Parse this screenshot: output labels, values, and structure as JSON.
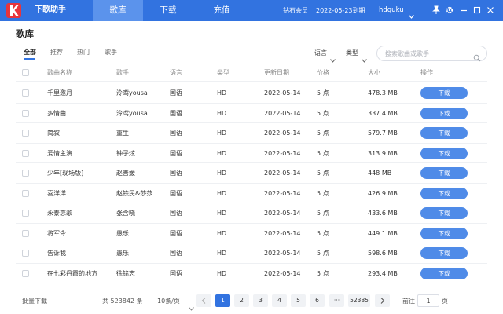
{
  "app": {
    "title": "下歌助手",
    "nav": [
      "歌库",
      "下载",
      "充值"
    ],
    "vip_label": "钻石会员",
    "expiry": "2022-05-23到期",
    "username": "hdquku"
  },
  "colors": {
    "topbar": "#3273e0",
    "nav_active": "#5b93ec",
    "logo": "#e8343c",
    "button": "#4f8be8"
  },
  "page": {
    "title": "歌库"
  },
  "sub_tabs": [
    "全部",
    "推荐",
    "热门",
    "歌手"
  ],
  "filters": {
    "language": "语言",
    "type": "类型"
  },
  "search": {
    "placeholder": "搜索歌曲或歌手"
  },
  "table": {
    "headers": [
      "歌曲名称",
      "歌手",
      "语言",
      "类型",
      "更新日期",
      "价格",
      "大小",
      "操作"
    ],
    "download_label": "下载",
    "rows": [
      [
        "千里邀月",
        "泠鸢yousa",
        "国语",
        "HD",
        "2022-05-14",
        "5 点",
        "478.3 MB"
      ],
      [
        "多情曲",
        "泠鸢yousa",
        "国语",
        "HD",
        "2022-05-14",
        "5 点",
        "337.4 MB"
      ],
      [
        "简叙",
        "重生",
        "国语",
        "HD",
        "2022-05-14",
        "5 点",
        "579.7 MB"
      ],
      [
        "爱情主演",
        "钟子炫",
        "国语",
        "HD",
        "2022-05-14",
        "5 点",
        "313.9 MB"
      ],
      [
        "少年[现场版]",
        "赵善媛",
        "国语",
        "HD",
        "2022-05-14",
        "5 点",
        "448 MB"
      ],
      [
        "喜洋洋",
        "赵铁民&莎莎",
        "国语",
        "HD",
        "2022-05-14",
        "5 点",
        "426.9 MB"
      ],
      [
        "永泰恋歌",
        "张含晓",
        "国语",
        "HD",
        "2022-05-14",
        "5 点",
        "433.6 MB"
      ],
      [
        "将军令",
        "愚乐",
        "国语",
        "HD",
        "2022-05-14",
        "5 点",
        "449.1 MB"
      ],
      [
        "告诉我",
        "愚乐",
        "国语",
        "HD",
        "2022-05-14",
        "5 点",
        "598.6 MB"
      ],
      [
        "在七彩丹霞的地方",
        "徐铭志",
        "国语",
        "HD",
        "2022-05-14",
        "5 点",
        "293.4 MB"
      ]
    ]
  },
  "footer": {
    "batch_download": "批量下载",
    "total": "共 523842 条",
    "page_size": "10条/页",
    "pages": [
      "1",
      "2",
      "3",
      "4",
      "5",
      "6",
      "···",
      "52385"
    ],
    "current_page": "1",
    "goto_label": "前往",
    "goto_value": "1",
    "page_unit": "页"
  }
}
